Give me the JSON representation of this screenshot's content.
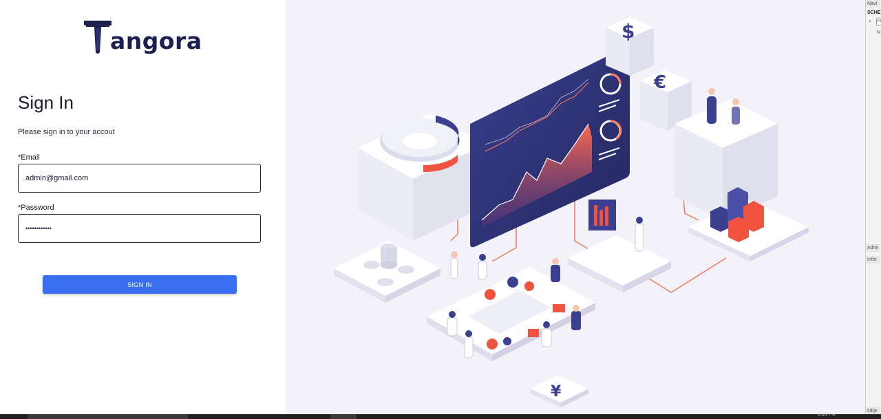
{
  "logo": {
    "text": "angora"
  },
  "login": {
    "title": "Sign In",
    "subtitle": "Please sign in to your accout",
    "email_label": "*Email",
    "email_value": "admin@gmail.com",
    "password_label": "*Password",
    "password_value": "••••••••••••",
    "signin_label": "SIGN IN",
    "accent_color": "#3b6ff0"
  },
  "illustration": {
    "currency_symbols": [
      "$",
      "€",
      "¥"
    ]
  },
  "side_panel": {
    "header_nav": "Navi",
    "schema": "SCHE",
    "filter_placeholder": "Fi",
    "item_n": "N",
    "header_admin": "Admi",
    "header_info": "Infor",
    "footer_objects": "Obje"
  },
  "taskbar": {
    "clock": "3:05 PM"
  }
}
